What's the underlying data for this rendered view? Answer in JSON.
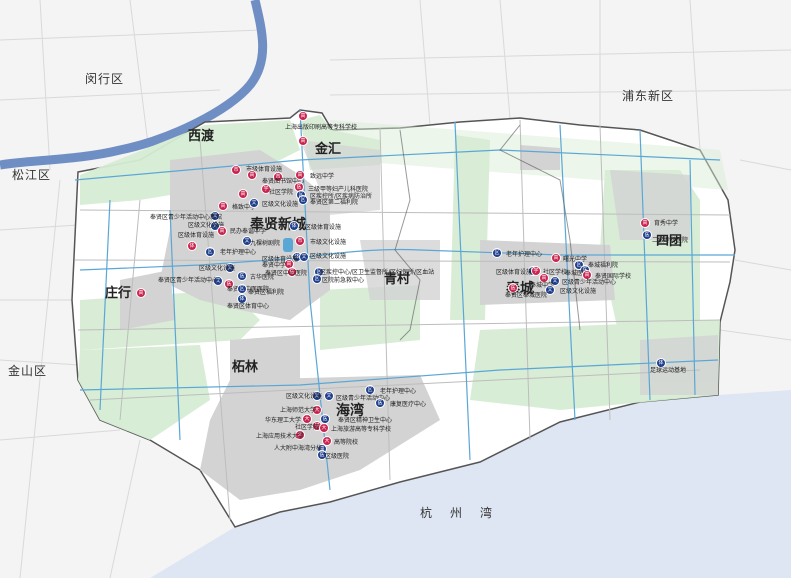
{
  "regions": {
    "minhang": "闵行区",
    "songjiang": "松江区",
    "jinshan": "金山区",
    "pudong": "浦东新区"
  },
  "towns": {
    "xidu": "西渡",
    "jinhui": "金汇",
    "xincheng": "奉贤新城",
    "zhuanghang": "庄行",
    "qingcun": "青村",
    "fengcheng": "奉城",
    "situan": "四团",
    "zhelin": "柘林",
    "haiwan": "海湾"
  },
  "sea_label": "杭州湾",
  "colors": {
    "school": "#c8244f",
    "facility": "#1f3f8c",
    "green": "#d6ecd4",
    "water": "#dfe6f3",
    "river": "#5aa7d6"
  },
  "facilities": [
    {
      "label": "上海出版印刷高等专科学校",
      "kind": "red",
      "glyph": "高"
    },
    {
      "label": "",
      "kind": "red",
      "glyph": "高"
    },
    {
      "label": "市级体育设施",
      "kind": "red",
      "glyph": "市"
    },
    {
      "label": "奉贤图书馆中心",
      "kind": "red",
      "glyph": "市"
    },
    {
      "label": "社区学院",
      "kind": "red",
      "glyph": "学"
    },
    {
      "label": "致远中学",
      "kind": "red",
      "glyph": "高"
    },
    {
      "label": "三级甲等妇产儿科医院",
      "kind": "red",
      "glyph": "医"
    },
    {
      "label": "区疾控所/区疾病防治所",
      "kind": "blue",
      "glyph": "区"
    },
    {
      "label": "奉贤区第二福利院",
      "kind": "blue",
      "glyph": "区"
    },
    {
      "label": "格致中学",
      "kind": "red",
      "glyph": "高"
    },
    {
      "label": "区级文化设施",
      "kind": "blue",
      "glyph": "文"
    },
    {
      "label": "奉贤区青少年活动中心新馆",
      "kind": "blue",
      "glyph": "文"
    },
    {
      "label": "区级文化设施",
      "kind": "blue",
      "glyph": "文"
    },
    {
      "label": "区级体育设施",
      "kind": "blue",
      "glyph": "体"
    },
    {
      "label": "民办奉谐中学",
      "kind": "red",
      "glyph": "高"
    },
    {
      "label": "九棵树剧院",
      "kind": "blue",
      "glyph": "文"
    },
    {
      "label": "区级体育设施",
      "kind": "red",
      "glyph": "体"
    },
    {
      "label": "老年护理中心",
      "kind": "blue",
      "glyph": "区"
    },
    {
      "label": "市级文化设施",
      "kind": "red",
      "glyph": "市"
    },
    {
      "label": "区级体育设施",
      "kind": "blue",
      "glyph": "体"
    },
    {
      "label": "区级文化设施",
      "kind": "blue",
      "glyph": "文"
    },
    {
      "label": "奉贤中学",
      "kind": "red",
      "glyph": "高"
    },
    {
      "label": "区级文化设施",
      "kind": "blue",
      "glyph": "文"
    },
    {
      "label": "奉贤区中心医院",
      "kind": "red",
      "glyph": "医"
    },
    {
      "label": "区疾控中心/区卫生监督所/区妇保所/区血站",
      "kind": "blue",
      "glyph": "区"
    },
    {
      "label": "区院前急救中心",
      "kind": "blue",
      "glyph": "区"
    },
    {
      "label": "古华医院",
      "kind": "blue",
      "glyph": "医"
    },
    {
      "label": "奉贤区青少年活动中心",
      "kind": "blue",
      "glyph": "文"
    },
    {
      "label": "奉贤区中医医院",
      "kind": "red",
      "glyph": "医"
    },
    {
      "label": "奉贤区福利院",
      "kind": "blue",
      "glyph": "区"
    },
    {
      "label": "奉贤区体育中心",
      "kind": "blue",
      "glyph": "体"
    },
    {
      "label": "",
      "kind": "red",
      "glyph": "高"
    },
    {
      "label": "",
      "kind": "red",
      "glyph": "高"
    },
    {
      "label": "",
      "kind": "red",
      "glyph": "高"
    },
    {
      "label": "老年护理中心",
      "kind": "blue",
      "glyph": "区"
    },
    {
      "label": "区级文化设施",
      "kind": "blue",
      "glyph": "文"
    },
    {
      "label": "区级青少年活动中心",
      "kind": "blue",
      "glyph": "文"
    },
    {
      "label": "康复医疗中心",
      "kind": "blue",
      "glyph": "医"
    },
    {
      "label": "上海师范大学",
      "kind": "red",
      "glyph": "大"
    },
    {
      "label": "华东理工大学",
      "kind": "red",
      "glyph": "大"
    },
    {
      "label": "奉贤区精神卫生中心",
      "kind": "blue",
      "glyph": "医"
    },
    {
      "label": "社区学院",
      "kind": "red",
      "glyph": "学"
    },
    {
      "label": "上海旅游高等专科学校",
      "kind": "red",
      "glyph": "大"
    },
    {
      "label": "上海应用技术大学",
      "kind": "red",
      "glyph": "大"
    },
    {
      "label": "高等院校",
      "kind": "red",
      "glyph": "大"
    },
    {
      "label": "人大附中海湾分校",
      "kind": "blue",
      "glyph": "高"
    },
    {
      "label": "区级医院",
      "kind": "blue",
      "glyph": "医"
    },
    {
      "label": "老年护理中心",
      "kind": "blue",
      "glyph": "区"
    },
    {
      "label": "区级体育设施",
      "kind": "blue",
      "glyph": "体"
    },
    {
      "label": "社区学校",
      "kind": "red",
      "glyph": "学"
    },
    {
      "label": "曙光中学",
      "kind": "red",
      "glyph": "高"
    },
    {
      "label": "奉城福利院",
      "kind": "blue",
      "glyph": "区"
    },
    {
      "label": "奉城医院",
      "kind": "blue",
      "glyph": "医"
    },
    {
      "label": "奉贤国际学校",
      "kind": "red",
      "glyph": "高"
    },
    {
      "label": "区级青少年活动中心",
      "kind": "blue",
      "glyph": "文"
    },
    {
      "label": "奉城中学",
      "kind": "red",
      "glyph": "高"
    },
    {
      "label": "区级文化设施",
      "kind": "blue",
      "glyph": "文"
    },
    {
      "label": "奉贤区奉城医院",
      "kind": "red",
      "glyph": "医"
    },
    {
      "label": "育秀中学",
      "kind": "red",
      "glyph": "高"
    },
    {
      "label": "二级专科医院",
      "kind": "blue",
      "glyph": "医"
    },
    {
      "label": "足球运动基地",
      "kind": "blue",
      "glyph": "体"
    }
  ]
}
